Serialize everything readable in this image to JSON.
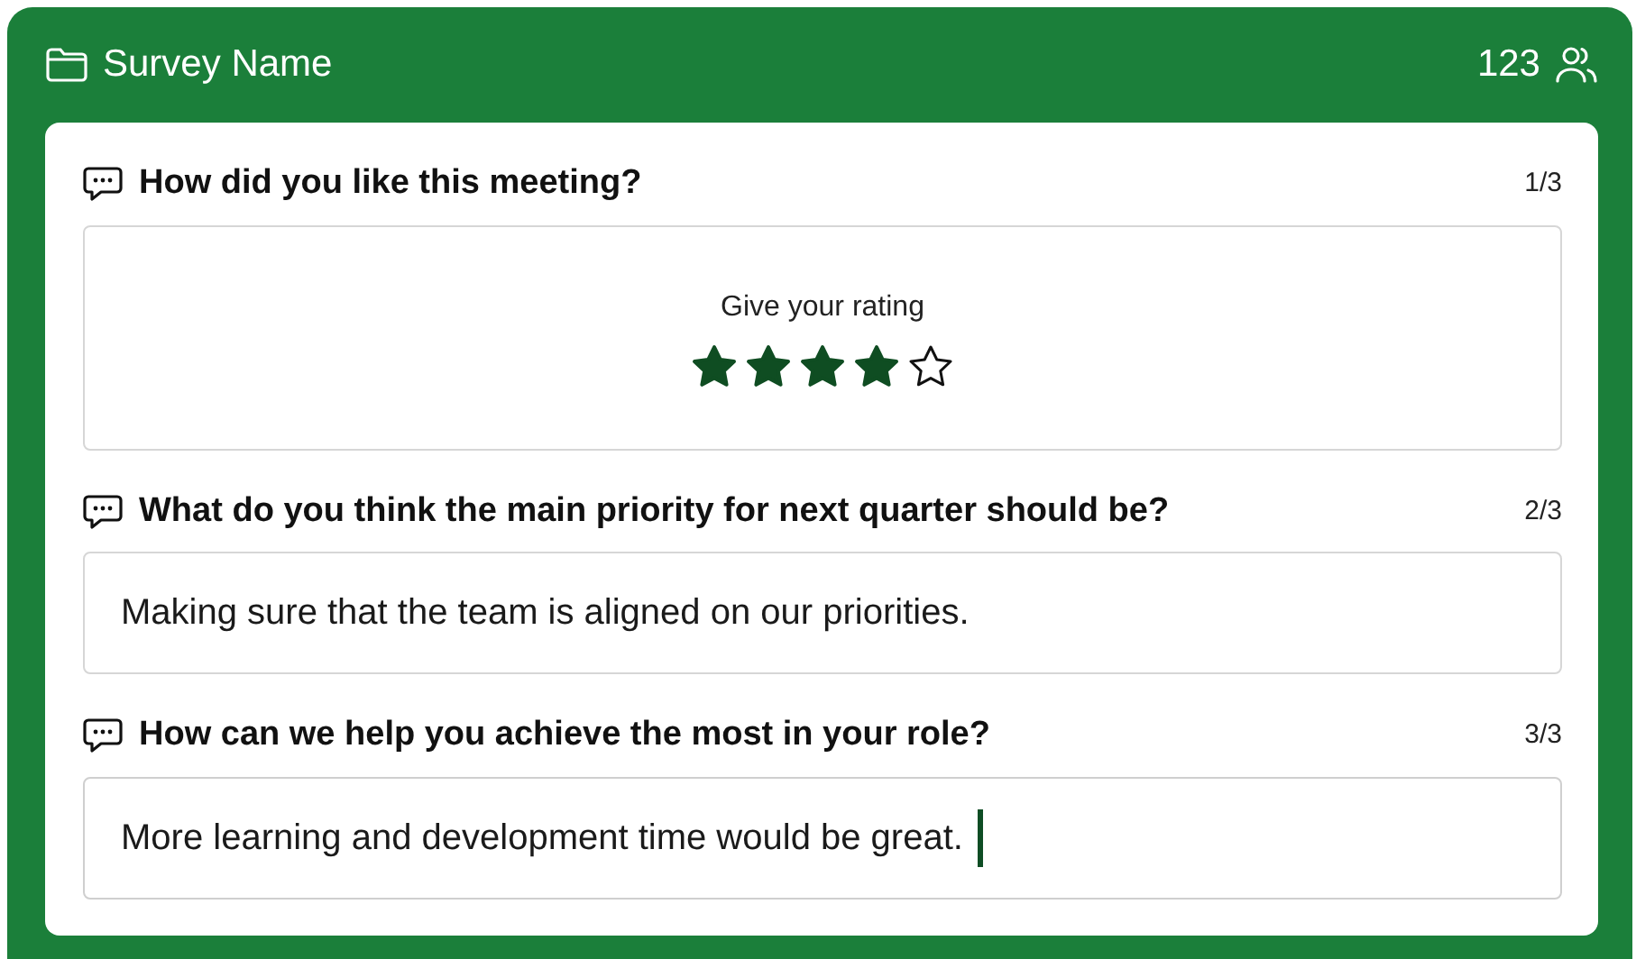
{
  "header": {
    "title": "Survey Name",
    "count": "123"
  },
  "questions": [
    {
      "kind": "rating",
      "title": "How did you like this meeting?",
      "progress": "1/3",
      "prompt": "Give your rating",
      "stars": 4
    },
    {
      "kind": "text",
      "title": "What do you think the main priority for next quarter should be?",
      "progress": "2/3",
      "value": "Making sure that the team is aligned on our priorities.",
      "focused": false
    },
    {
      "kind": "text",
      "title": "How can we help you achieve the most in your role?",
      "progress": "3/3",
      "value": "More learning and development time would be great.",
      "focused": true
    }
  ]
}
